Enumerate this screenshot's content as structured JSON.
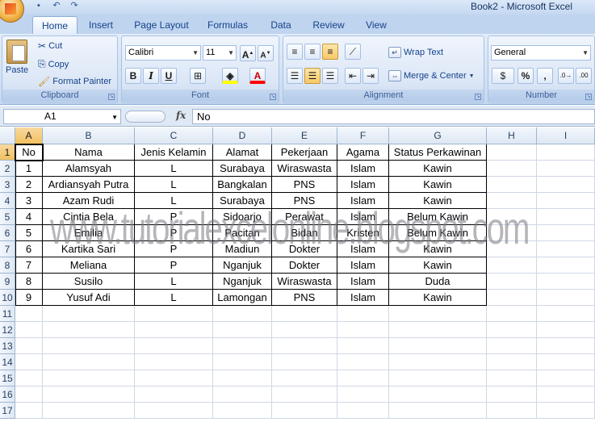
{
  "window": {
    "title": "Book2 - Microsoft Excel"
  },
  "tabs": [
    "Home",
    "Insert",
    "Page Layout",
    "Formulas",
    "Data",
    "Review",
    "View"
  ],
  "ribbon": {
    "clipboard": {
      "label": "Clipboard",
      "paste": "Paste",
      "cut": "Cut",
      "copy": "Copy",
      "format_painter": "Format Painter"
    },
    "font": {
      "label": "Font",
      "font_name": "Calibri",
      "font_size": "11"
    },
    "alignment": {
      "label": "Alignment",
      "wrap_text": "Wrap Text",
      "merge_center": "Merge & Center"
    },
    "number": {
      "label": "Number",
      "format": "General"
    }
  },
  "formula_bar": {
    "name_box": "A1",
    "fx": "fx",
    "content": "No"
  },
  "columns": [
    "A",
    "B",
    "C",
    "D",
    "E",
    "F",
    "G",
    "H",
    "I"
  ],
  "rows": [
    "1",
    "2",
    "3",
    "4",
    "5",
    "6",
    "7",
    "8",
    "9",
    "10",
    "11",
    "12",
    "13",
    "14",
    "15",
    "16",
    "17"
  ],
  "table": {
    "headers": [
      "No",
      "Nama",
      "Jenis Kelamin",
      "Alamat",
      "Pekerjaan",
      "Agama",
      "Status Perkawinan"
    ],
    "rows": [
      [
        "1",
        "Alamsyah",
        "L",
        "Surabaya",
        "Wiraswasta",
        "Islam",
        "Kawin"
      ],
      [
        "2",
        "Ardiansyah Putra",
        "L",
        "Bangkalan",
        "PNS",
        "Islam",
        "Kawin"
      ],
      [
        "3",
        "Azam Rudi",
        "L",
        "Surabaya",
        "PNS",
        "Islam",
        "Kawin"
      ],
      [
        "4",
        "Cintia Bela",
        "P",
        "Sidoarjo",
        "Perawat",
        "Islam",
        "Belum Kawin"
      ],
      [
        "5",
        "Emilia",
        "P",
        "Pacitan",
        "Bidan",
        "Kristen",
        "Belum Kawin"
      ],
      [
        "6",
        "Kartika Sari",
        "P",
        "Madiun",
        "Dokter",
        "Islam",
        "Kawin"
      ],
      [
        "7",
        "Meliana",
        "P",
        "Nganjuk",
        "Dokter",
        "Islam",
        "Kawin"
      ],
      [
        "8",
        "Susilo",
        "L",
        "Nganjuk",
        "Wiraswasta",
        "Islam",
        "Duda"
      ],
      [
        "9",
        "Yusuf Adi",
        "L",
        "Lamongan",
        "PNS",
        "Islam",
        "Kawin"
      ]
    ]
  },
  "watermark": "www.tutorialexcelonline.blogspot.com"
}
